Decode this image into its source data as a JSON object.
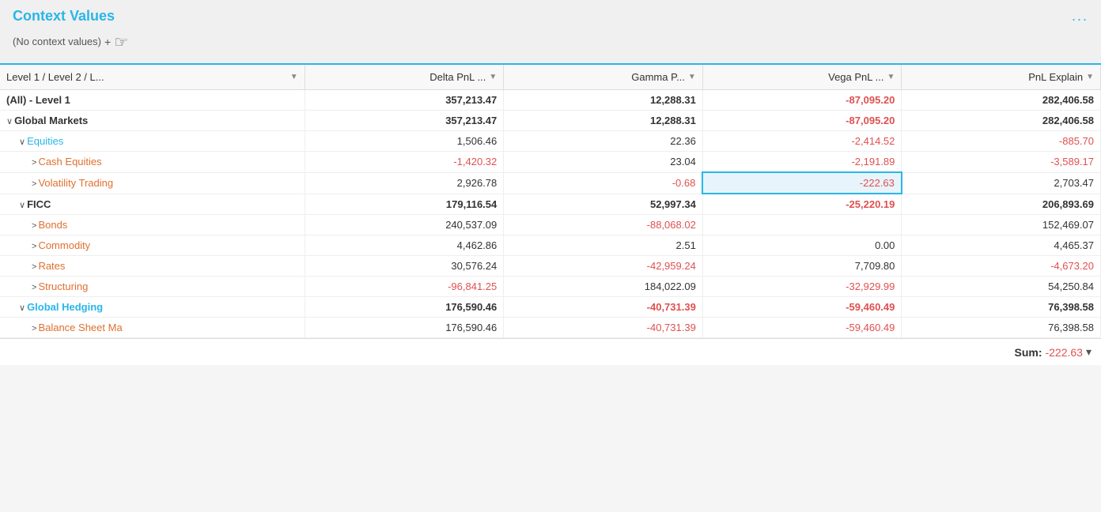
{
  "header": {
    "title": "Context Values",
    "more_icon": "...",
    "no_context_label": "(No context values)",
    "add_icon": "+"
  },
  "columns": [
    {
      "id": "level",
      "label": "Level 1 / Level 2 / L...",
      "has_dropdown": true
    },
    {
      "id": "delta",
      "label": "Delta PnL ...",
      "has_dropdown": true
    },
    {
      "id": "gamma",
      "label": "Gamma P...",
      "has_dropdown": true
    },
    {
      "id": "vega",
      "label": "Vega PnL ...",
      "has_dropdown": true
    },
    {
      "id": "pnl",
      "label": "PnL Explain",
      "has_dropdown": true
    }
  ],
  "rows": [
    {
      "id": "all-level1",
      "level": "(All) - Level 1",
      "indent": 0,
      "bold": true,
      "link": false,
      "link_color": "none",
      "expand": null,
      "delta": "357,213.47",
      "gamma": "12,288.31",
      "vega": "-87,095.20",
      "pnl": "282,406.58",
      "vega_negative": true,
      "delta_negative": false,
      "gamma_negative": false,
      "pnl_negative": false
    },
    {
      "id": "global-markets",
      "level": "Global Markets",
      "indent": 0,
      "bold": true,
      "link": false,
      "link_color": "none",
      "expand": "collapse",
      "delta": "357,213.47",
      "gamma": "12,288.31",
      "vega": "-87,095.20",
      "pnl": "282,406.58",
      "vega_negative": true,
      "delta_negative": false,
      "gamma_negative": false,
      "pnl_negative": false
    },
    {
      "id": "equities",
      "level": "Equities",
      "indent": 1,
      "bold": false,
      "link": true,
      "link_color": "blue",
      "expand": "collapse",
      "delta": "1,506.46",
      "gamma": "22.36",
      "vega": "-2,414.52",
      "pnl": "-885.70",
      "vega_negative": true,
      "delta_negative": false,
      "gamma_negative": false,
      "pnl_negative": true
    },
    {
      "id": "cash-equities",
      "level": "Cash Equities",
      "indent": 2,
      "bold": false,
      "link": true,
      "link_color": "orange",
      "expand": "expand",
      "delta": "-1,420.32",
      "gamma": "23.04",
      "vega": "-2,191.89",
      "pnl": "-3,589.17",
      "vega_negative": true,
      "delta_negative": true,
      "gamma_negative": false,
      "pnl_negative": true
    },
    {
      "id": "volatility-trading",
      "level": "Volatility Trading",
      "indent": 2,
      "bold": false,
      "link": true,
      "link_color": "orange",
      "expand": "expand",
      "delta": "2,926.78",
      "gamma": "-0.68",
      "vega": "-222.63",
      "pnl": "2,703.47",
      "vega_negative": true,
      "delta_negative": false,
      "gamma_negative": true,
      "pnl_negative": false,
      "vega_selected": true
    },
    {
      "id": "ficc",
      "level": "FICC",
      "indent": 1,
      "bold": true,
      "link": false,
      "link_color": "none",
      "expand": "collapse",
      "delta": "179,116.54",
      "gamma": "52,997.34",
      "vega": "-25,220.19",
      "pnl": "206,893.69",
      "vega_negative": true,
      "delta_negative": false,
      "gamma_negative": false,
      "pnl_negative": false
    },
    {
      "id": "bonds",
      "level": "Bonds",
      "indent": 2,
      "bold": false,
      "link": true,
      "link_color": "orange",
      "expand": "expand",
      "delta": "240,537.09",
      "gamma": "-88,068.02",
      "vega": "",
      "pnl": "152,469.07",
      "vega_negative": false,
      "delta_negative": false,
      "gamma_negative": true,
      "pnl_negative": false
    },
    {
      "id": "commodity",
      "level": "Commodity",
      "indent": 2,
      "bold": false,
      "link": true,
      "link_color": "orange",
      "expand": "expand",
      "delta": "4,462.86",
      "gamma": "2.51",
      "vega": "0.00",
      "pnl": "4,465.37",
      "vega_negative": false,
      "delta_negative": false,
      "gamma_negative": false,
      "pnl_negative": false
    },
    {
      "id": "rates",
      "level": "Rates",
      "indent": 2,
      "bold": false,
      "link": true,
      "link_color": "orange",
      "expand": "expand",
      "delta": "30,576.24",
      "gamma": "-42,959.24",
      "vega": "7,709.80",
      "pnl": "-4,673.20",
      "vega_negative": false,
      "delta_negative": false,
      "gamma_negative": true,
      "pnl_negative": true
    },
    {
      "id": "structuring",
      "level": "Structuring",
      "indent": 2,
      "bold": false,
      "link": true,
      "link_color": "orange",
      "expand": "expand",
      "delta": "-96,841.25",
      "gamma": "184,022.09",
      "vega": "-32,929.99",
      "pnl": "54,250.84",
      "vega_negative": true,
      "delta_negative": true,
      "gamma_negative": false,
      "pnl_negative": false
    },
    {
      "id": "global-hedging",
      "level": "Global Hedging",
      "indent": 1,
      "bold": true,
      "link": true,
      "link_color": "blue",
      "expand": "collapse",
      "delta": "176,590.46",
      "gamma": "-40,731.39",
      "vega": "-59,460.49",
      "pnl": "76,398.58",
      "vega_negative": true,
      "delta_negative": false,
      "gamma_negative": true,
      "pnl_negative": false
    },
    {
      "id": "balance-sheet-ma",
      "level": "Balance Sheet Ma",
      "indent": 2,
      "bold": false,
      "link": true,
      "link_color": "orange",
      "expand": "expand",
      "delta": "176,590.46",
      "gamma": "-40,731.39",
      "vega": "-59,460.49",
      "pnl": "76,398.58",
      "vega_negative": true,
      "delta_negative": false,
      "gamma_negative": true,
      "pnl_negative": false
    }
  ],
  "sum_bar": {
    "label": "Sum:",
    "value": "-222.63",
    "dropdown_icon": "▾"
  }
}
